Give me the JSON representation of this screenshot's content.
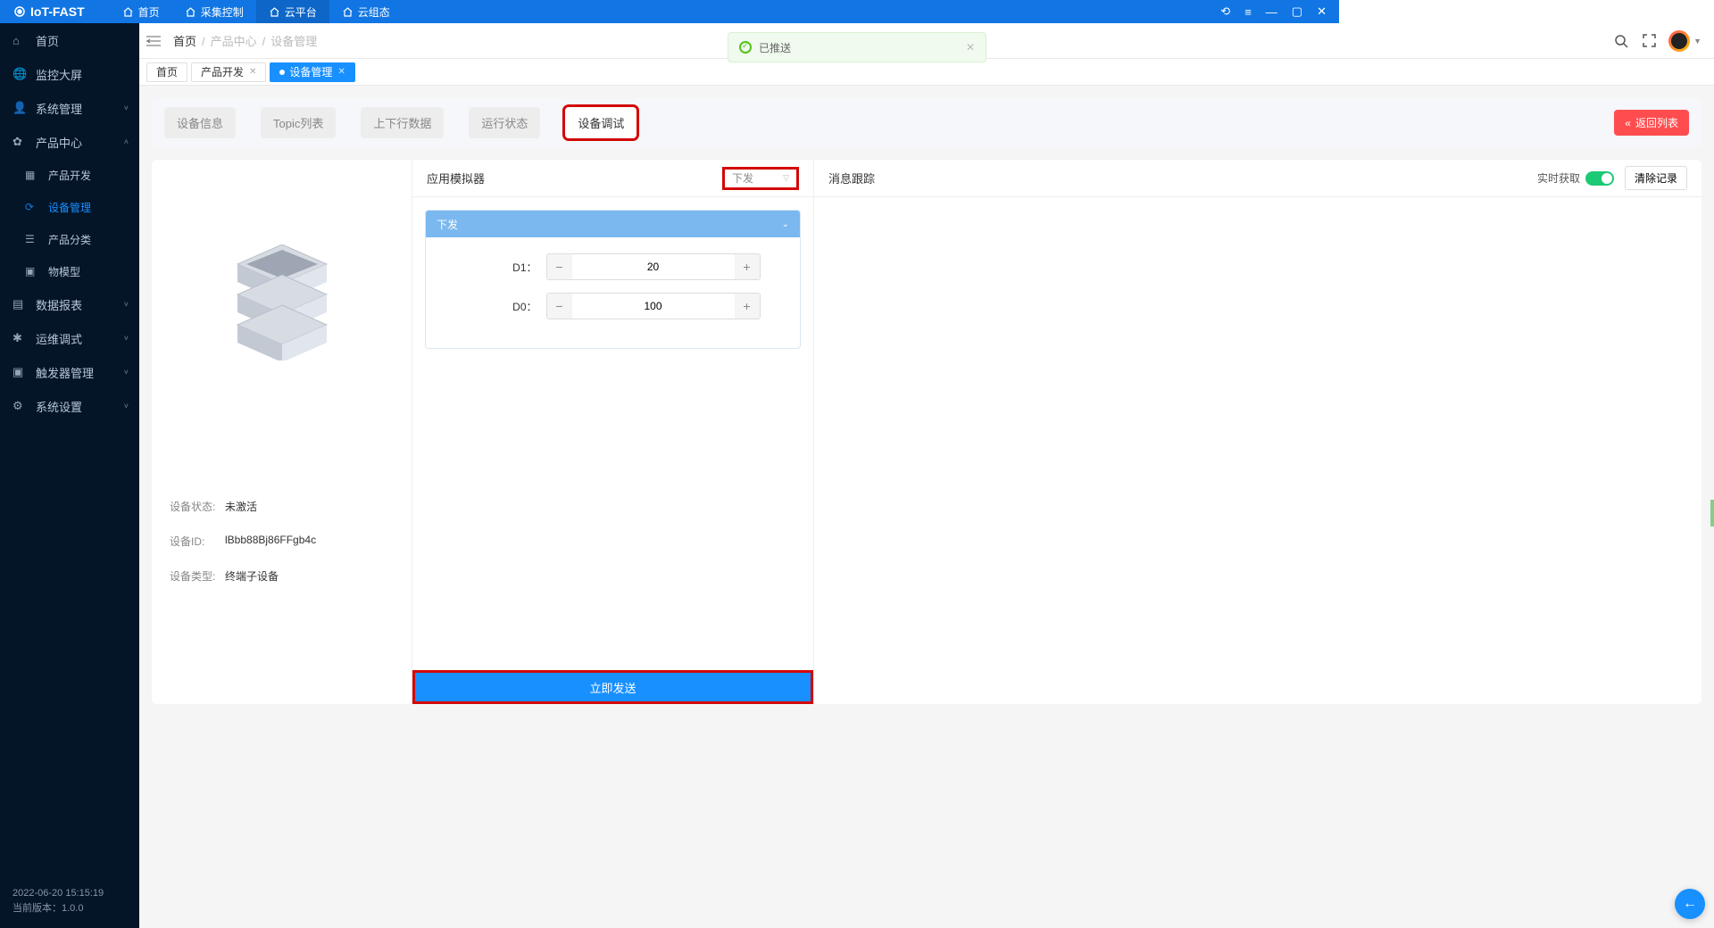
{
  "app_title": "IoT-FAST",
  "titlebar_nav": [
    "首页",
    "采集控制",
    "云平台",
    "云组态"
  ],
  "titlebar_active_index": 2,
  "sidebar": {
    "items": [
      {
        "label": "首页",
        "icon": "home"
      },
      {
        "label": "监控大屏",
        "icon": "globe"
      },
      {
        "label": "系统管理",
        "icon": "user",
        "expandable": true
      },
      {
        "label": "产品中心",
        "icon": "gear",
        "expandable": true,
        "expanded": true,
        "children": [
          {
            "label": "产品开发",
            "icon": "box"
          },
          {
            "label": "设备管理",
            "icon": "refresh",
            "active": true
          },
          {
            "label": "产品分类",
            "icon": "list"
          },
          {
            "label": "物模型",
            "icon": "cube"
          }
        ]
      },
      {
        "label": "数据报表",
        "icon": "chart",
        "expandable": true
      },
      {
        "label": "运维调式",
        "icon": "bug",
        "expandable": true
      },
      {
        "label": "触发器管理",
        "icon": "trigger",
        "expandable": true
      },
      {
        "label": "系统设置",
        "icon": "cog",
        "expandable": true
      }
    ],
    "timestamp": "2022-06-20 15:15:19",
    "version_label": "当前版本：1.0.0"
  },
  "breadcrumb": [
    "首页",
    "产品中心",
    "设备管理"
  ],
  "page_tabs": [
    {
      "label": "首页",
      "closable": false
    },
    {
      "label": "产品开发",
      "closable": true
    },
    {
      "label": "设备管理",
      "closable": true,
      "active": true
    }
  ],
  "content_tabs": [
    "设备信息",
    "Topic列表",
    "上下行数据",
    "运行状态",
    "设备调试"
  ],
  "content_tab_active": 4,
  "back_button": "返回列表",
  "device": {
    "status_label": "设备状态:",
    "status_value": "未激活",
    "id_label": "设备ID:",
    "id_value": "lBbb88Bj86FFgb4c",
    "type_label": "设备类型:",
    "type_value": "终端子设备"
  },
  "simulator": {
    "title": "应用模拟器",
    "mode": "下发",
    "accordion_title": "下发",
    "fields": [
      {
        "label": "D1：",
        "value": "20"
      },
      {
        "label": "D0：",
        "value": "100"
      }
    ],
    "send_button": "立即发送"
  },
  "trace": {
    "title": "消息跟踪",
    "realtime_label": "实时获取",
    "clear_button": "清除记录"
  },
  "toast_text": "已推送"
}
